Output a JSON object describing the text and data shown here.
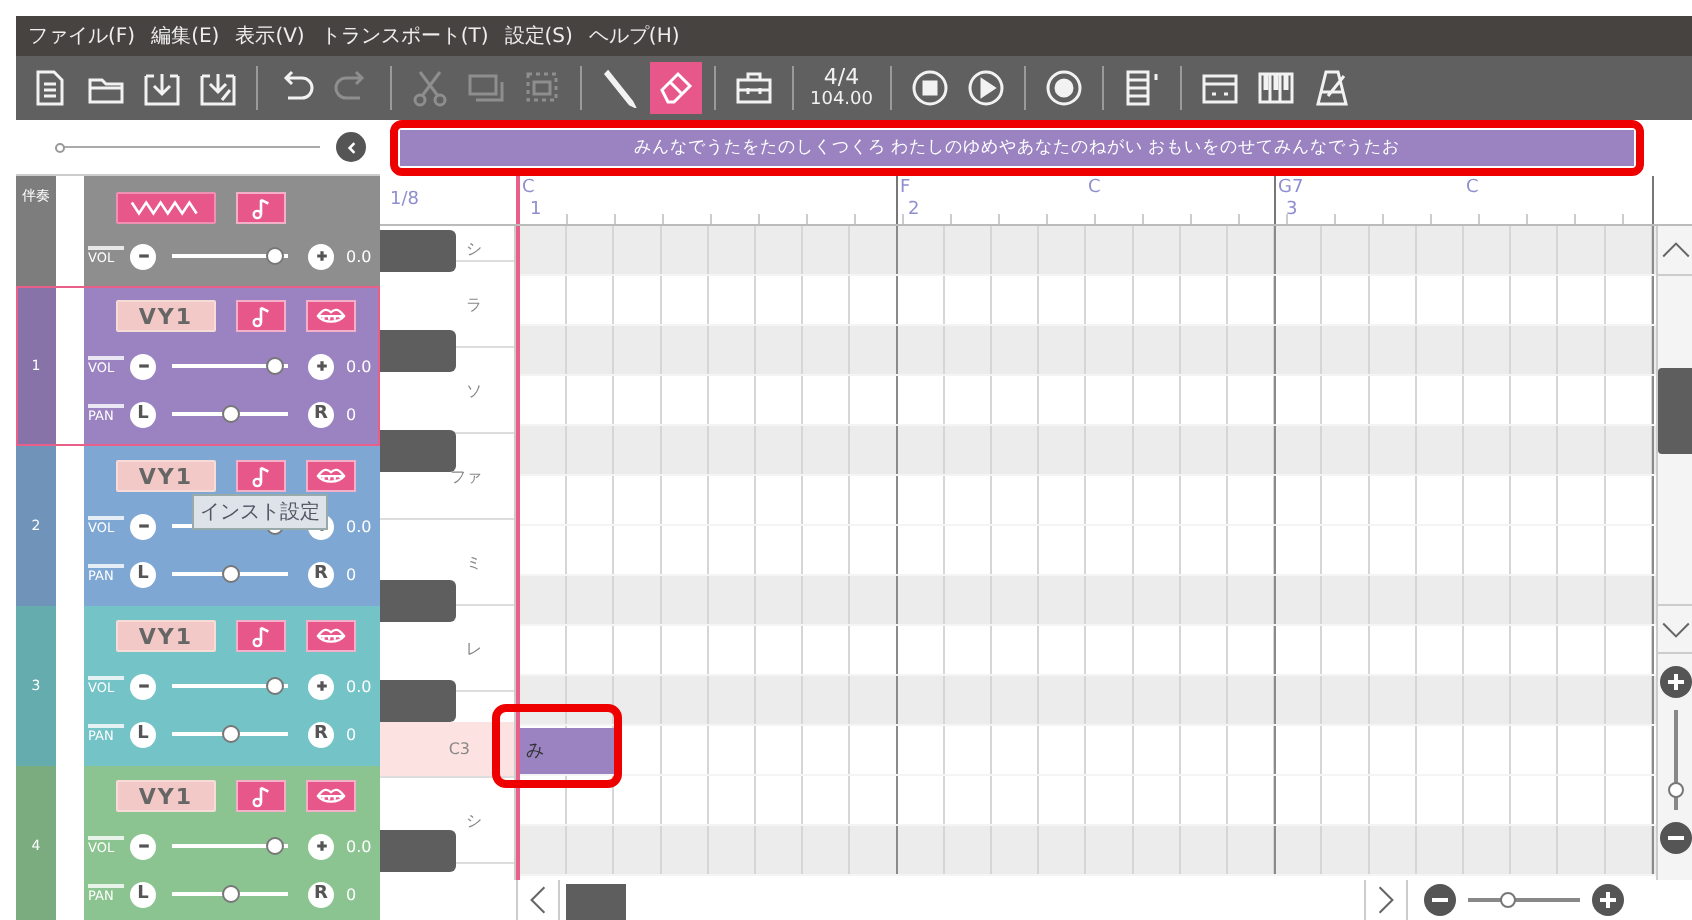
{
  "menu": [
    "ファイル(F)",
    "編集(E)",
    "表示(V)",
    "トランスポート(T)",
    "設定(S)",
    "ヘルプ(H)"
  ],
  "toolbar": [
    {
      "items": [
        {
          "kind": "document",
          "disabled": false,
          "selected": false
        },
        {
          "kind": "folder",
          "disabled": false,
          "selected": false
        },
        {
          "kind": "import",
          "disabled": false,
          "selected": false
        },
        {
          "kind": "export",
          "disabled": false,
          "selected": false
        }
      ]
    },
    {
      "items": [
        {
          "kind": "undo",
          "disabled": false,
          "selected": false
        },
        {
          "kind": "redo",
          "disabled": true,
          "selected": false
        }
      ]
    },
    {
      "items": [
        {
          "kind": "scissors",
          "disabled": true,
          "selected": false
        },
        {
          "kind": "copy",
          "disabled": true,
          "selected": false
        },
        {
          "kind": "paste",
          "disabled": true,
          "selected": false
        }
      ]
    },
    {
      "items": [
        {
          "kind": "pencil",
          "disabled": false,
          "selected": false
        },
        {
          "kind": "eraser",
          "disabled": false,
          "selected": true
        }
      ]
    },
    {
      "items": [
        {
          "kind": "toolbox",
          "disabled": false,
          "selected": false
        }
      ]
    },
    {
      "items": [
        {
          "kind": "tempo",
          "time_signature": "4/4",
          "tempo": "104.00"
        }
      ]
    },
    {
      "items": [
        {
          "kind": "stop",
          "disabled": false,
          "selected": false
        },
        {
          "kind": "play",
          "disabled": false,
          "selected": false
        }
      ]
    },
    {
      "items": [
        {
          "kind": "record",
          "disabled": false,
          "selected": false
        }
      ]
    },
    {
      "items": [
        {
          "kind": "score",
          "disabled": false,
          "selected": false
        }
      ]
    },
    {
      "items": [
        {
          "kind": "panel",
          "disabled": false,
          "selected": false
        },
        {
          "kind": "piano",
          "disabled": false,
          "selected": false
        },
        {
          "kind": "metronome",
          "disabled": false,
          "selected": false
        }
      ]
    }
  ],
  "track_zoom": {
    "level": 0.0
  },
  "lyrics_bar": {
    "text": "みんなでうたをたのしくつくろ わたしのゆめやあなたのねがい おもいをのせてみんなでうたお",
    "highlighted": true
  },
  "tracks": [
    {
      "kind": "accompaniment",
      "number": "伴奏",
      "color": "#8e8e8e",
      "selected": false,
      "instrument": {
        "kind": "wave"
      },
      "buttons": [
        {
          "kind": "note"
        }
      ],
      "volume": {
        "label": "VOL",
        "level": 0.95,
        "reading": "0.0"
      }
    },
    {
      "kind": "vocal",
      "number": "1",
      "color": "#9a83c0",
      "selected": true,
      "instrument": {
        "kind": "logo",
        "text": "VY1"
      },
      "buttons": [
        {
          "kind": "note"
        },
        {
          "kind": "lips"
        }
      ],
      "volume": {
        "label": "VOL",
        "level": 0.95,
        "reading": "0.0"
      },
      "pan": {
        "label": "PAN",
        "left": "L",
        "right": "R",
        "level": 0.5,
        "reading": "0"
      }
    },
    {
      "kind": "vocal",
      "number": "2",
      "color": "#7fa7d3",
      "selected": false,
      "instrument": {
        "kind": "logo",
        "text": "VY1"
      },
      "buttons": [
        {
          "kind": "note"
        },
        {
          "kind": "lips"
        }
      ],
      "volume": {
        "label": "VOL",
        "level": 0.95,
        "reading": "0.0"
      },
      "pan": {
        "label": "PAN",
        "left": "L",
        "right": "R",
        "level": 0.5,
        "reading": "0"
      }
    },
    {
      "kind": "vocal",
      "number": "3",
      "color": "#73c3c7",
      "selected": false,
      "instrument": {
        "kind": "logo",
        "text": "VY1"
      },
      "buttons": [
        {
          "kind": "note"
        },
        {
          "kind": "lips"
        }
      ],
      "volume": {
        "label": "VOL",
        "level": 0.95,
        "reading": "0.0"
      },
      "pan": {
        "label": "PAN",
        "left": "L",
        "right": "R",
        "level": 0.5,
        "reading": "0"
      }
    },
    {
      "kind": "vocal",
      "number": "4",
      "color": "#8bc491",
      "selected": false,
      "instrument": {
        "kind": "logo",
        "text": "VY1"
      },
      "buttons": [
        {
          "kind": "note"
        },
        {
          "kind": "lips"
        }
      ],
      "volume": {
        "label": "VOL",
        "level": 0.95,
        "reading": "0.0"
      },
      "pan": {
        "label": "PAN",
        "left": "L",
        "right": "R",
        "level": 0.5,
        "reading": "0"
      }
    }
  ],
  "tooltip": {
    "text": "インスト設定"
  },
  "ruler": {
    "grid_label": "1/8",
    "bars": [
      {
        "number": "1",
        "chords": [
          "C"
        ]
      },
      {
        "number": "2",
        "chords": [
          "F",
          "C"
        ]
      },
      {
        "number": "3",
        "chords": [
          "G7",
          "C"
        ]
      }
    ]
  },
  "piano_keys": [
    {
      "label": "シ",
      "selected": false
    },
    {
      "label": "ラ",
      "selected": false
    },
    {
      "label": "ソ",
      "selected": false
    },
    {
      "label": "ファ",
      "selected": false
    },
    {
      "label": "ミ",
      "selected": false
    },
    {
      "label": "レ",
      "selected": false
    },
    {
      "label": "C3",
      "selected": true
    },
    {
      "label": "シ",
      "selected": false
    }
  ],
  "rows": [
    {
      "kind": "black"
    },
    {
      "kind": "white"
    },
    {
      "kind": "black"
    },
    {
      "kind": "white"
    },
    {
      "kind": "black"
    },
    {
      "kind": "white"
    },
    {
      "kind": "white"
    },
    {
      "kind": "black"
    },
    {
      "kind": "white"
    },
    {
      "kind": "black"
    },
    {
      "kind": "white",
      "notes": [
        {
          "lyric": "み",
          "highlighted": true
        }
      ]
    },
    {
      "kind": "white"
    },
    {
      "kind": "black"
    }
  ],
  "vertical_zoom": {
    "level": 0.2
  },
  "horizontal_zoom": {
    "level": 0.35
  }
}
